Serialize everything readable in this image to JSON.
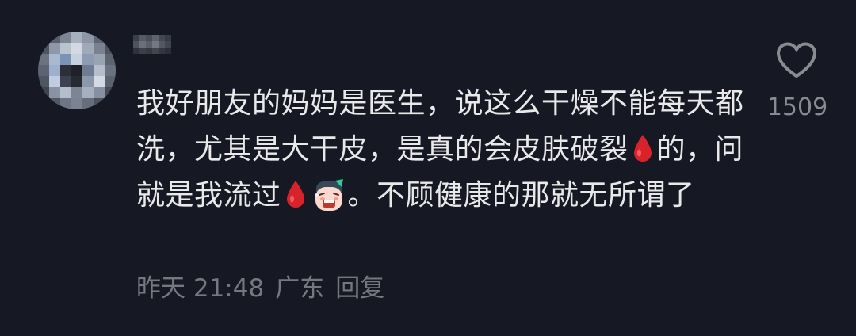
{
  "comment": {
    "avatar_alt": "",
    "text_segments": {
      "part1": "我好朋友的妈妈是医生，说这么干燥不能每天都洗，尤其是大干皮，是真的会皮肤破裂",
      "part2": "的，问就是我流过",
      "part3": "。不顾健康的那就无所谓了"
    },
    "emojis": {
      "drop": "blood-drop",
      "face": "grimace-face"
    },
    "meta": {
      "time": "昨天 21:48",
      "location": "广东",
      "reply_label": "回复"
    },
    "likes": {
      "count": "1509",
      "icon": "heart-outline-icon"
    }
  }
}
